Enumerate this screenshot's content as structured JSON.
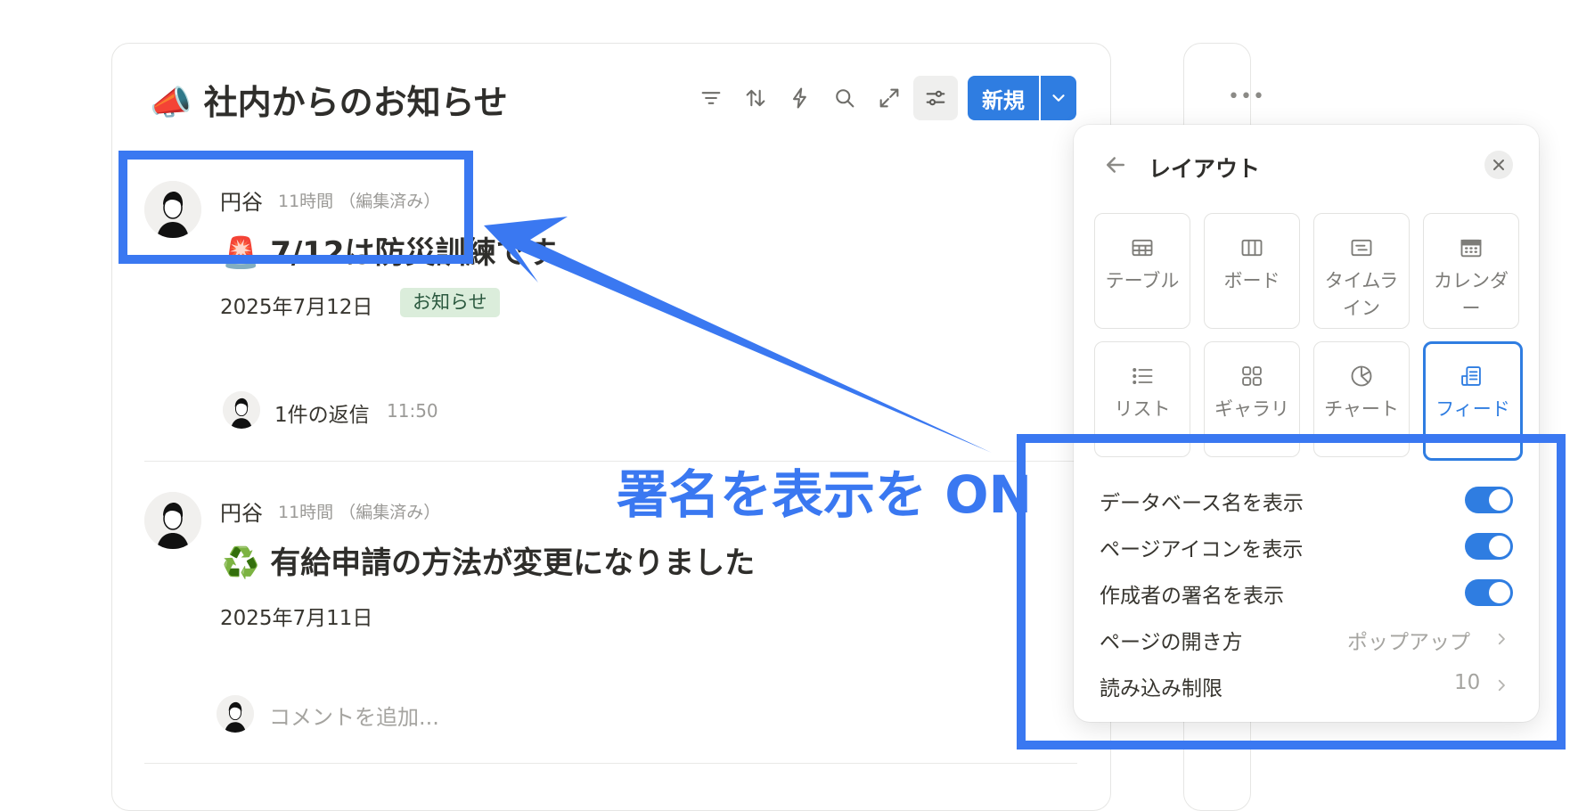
{
  "database": {
    "icon": "📣",
    "title": "社内からのお知らせ",
    "toolbar": {
      "icons": [
        "filter-icon",
        "sort-icon",
        "automation-icon",
        "search-icon",
        "expand-icon",
        "settings-icon"
      ],
      "new_label": "新規"
    }
  },
  "posts": [
    {
      "author": "円谷",
      "meta": "11時間 （編集済み）",
      "title_icon": "🚨",
      "title": "7/12は防災訓練です",
      "date": "2025年7月12日",
      "tag": "お知らせ",
      "tag_color": "#dbeddb",
      "reply_label": "1件の返信",
      "reply_time": "11:50"
    },
    {
      "author": "円谷",
      "meta": "11時間 （編集済み）",
      "title_icon": "♻️",
      "title": "有給申請の方法が変更になりました",
      "date": "2025年7月11日",
      "comment_placeholder": "コメントを追加..."
    }
  ],
  "layout_panel": {
    "title": "レイアウト",
    "options": [
      {
        "label": "テーブル",
        "icon": "table-icon"
      },
      {
        "label": "ボード",
        "icon": "board-icon"
      },
      {
        "label": "タイムライン",
        "icon": "timeline-icon"
      },
      {
        "label": "カレンダー",
        "icon": "calendar-icon"
      },
      {
        "label": "リスト",
        "icon": "list-icon"
      },
      {
        "label": "ギャラリ",
        "icon": "gallery-icon"
      },
      {
        "label": "チャート",
        "icon": "chart-icon"
      },
      {
        "label": "フィード",
        "icon": "feed-icon",
        "selected": true
      }
    ],
    "settings": [
      {
        "label": "データベース名を表示",
        "toggle": true
      },
      {
        "label": "ページアイコンを表示",
        "toggle": true
      },
      {
        "label": "作成者の署名を表示",
        "toggle": true
      },
      {
        "label": "ページの開き方",
        "value": "ポップアップ"
      },
      {
        "label": "読み込み制限",
        "value": "10"
      }
    ]
  },
  "annotation": {
    "text": "署名を表示を ON",
    "color": "#3a78f1"
  },
  "colors": {
    "accent": "#2f7de1",
    "annotation": "#3a78f1"
  }
}
